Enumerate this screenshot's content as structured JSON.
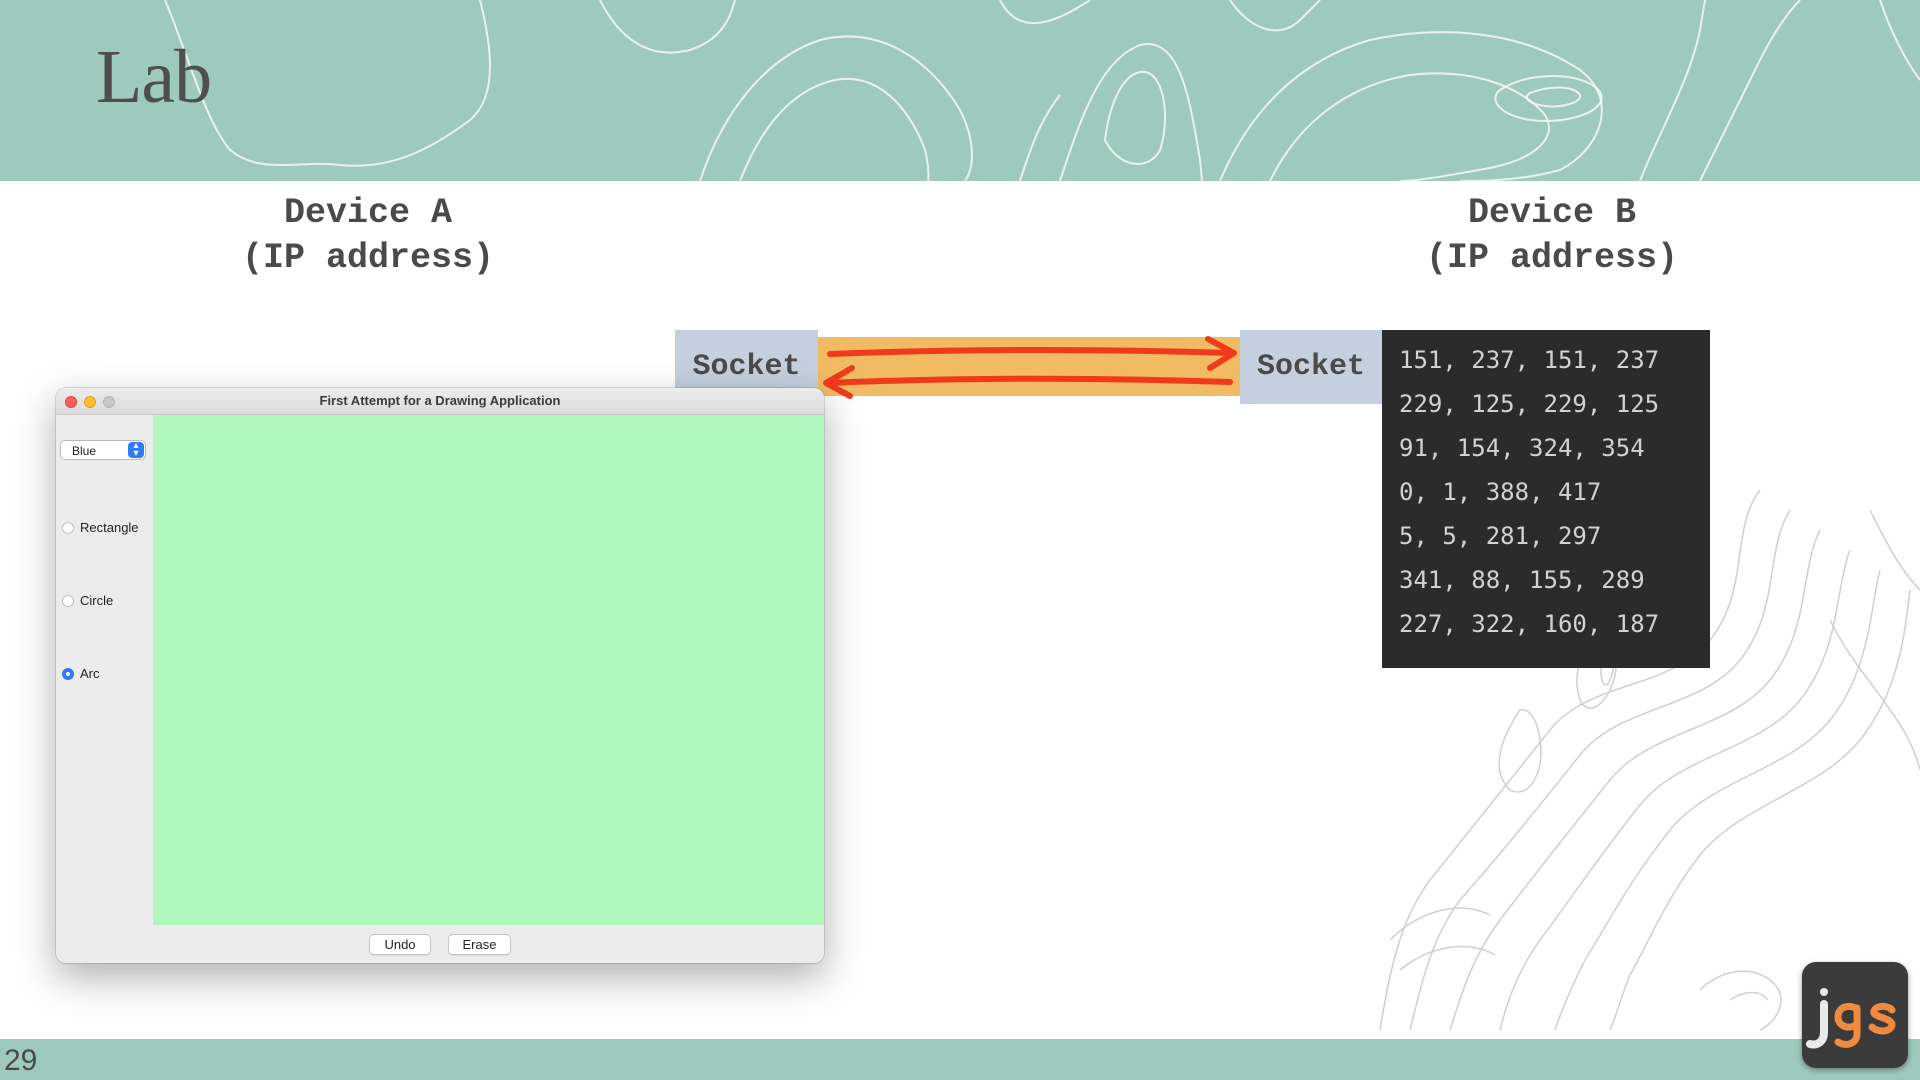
{
  "slide": {
    "title": "Lab",
    "page_number": "29"
  },
  "colors": {
    "banner": "#9ecabd",
    "socket": "#c5d0de",
    "pipe": "#f1bb63",
    "arrow": "#f03a1c",
    "console_bg": "#2b2b2b",
    "canvas": "#b0f8bd"
  },
  "device_a": {
    "name": "Device A",
    "address": "(IP address)",
    "socket_label": "Socket"
  },
  "device_b": {
    "name": "Device B",
    "address": "(IP address)",
    "socket_label": "Socket"
  },
  "console": {
    "lines": [
      "151, 237, 151, 237",
      "229, 125, 229, 125",
      "91, 154, 324, 354",
      "0, 1, 388, 417",
      "5, 5, 281, 297",
      "341, 88, 155, 289",
      "227, 322, 160, 187"
    ]
  },
  "app_window": {
    "title": "First Attempt for a Drawing Application",
    "color_select": {
      "value": "Blue"
    },
    "shapes": [
      {
        "label": "Rectangle",
        "selected": false
      },
      {
        "label": "Circle",
        "selected": false
      },
      {
        "label": "Arc",
        "selected": true
      }
    ],
    "buttons": {
      "undo": "Undo",
      "erase": "Erase"
    }
  },
  "logo": {
    "text": "jgs",
    "icon": "jgs-logo-icon"
  }
}
